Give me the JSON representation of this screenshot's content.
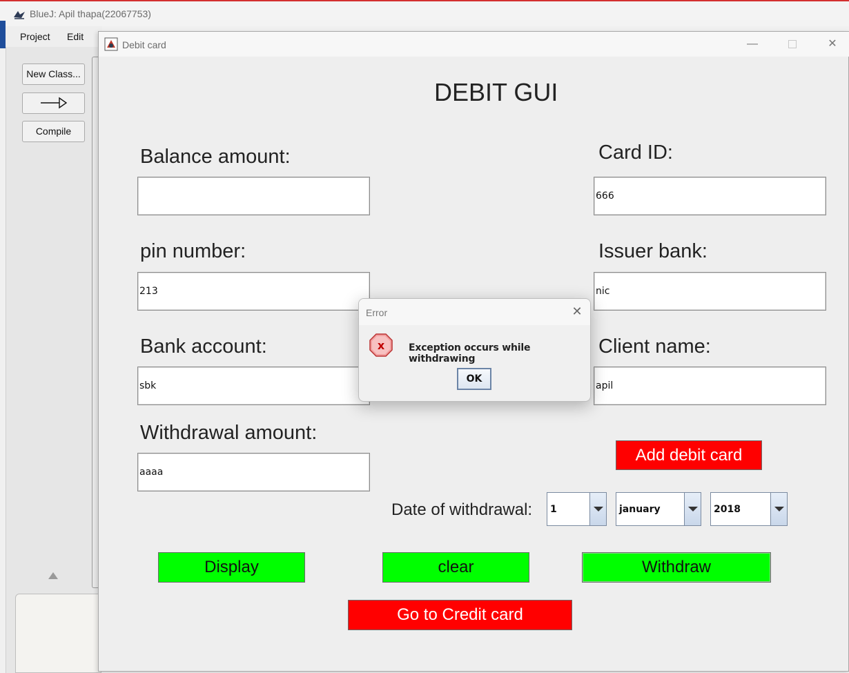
{
  "bluej": {
    "title": "BlueJ:  Apil thapa(22067753)",
    "menu": {
      "project": "Project",
      "edit": "Edit"
    },
    "buttons": {
      "new_class": "New Class...",
      "compile": "Compile"
    }
  },
  "debit_window": {
    "title": "Debit card",
    "heading": "DEBIT GUI",
    "fields": {
      "balance_amount": {
        "label": "Balance amount:",
        "value": ""
      },
      "card_id": {
        "label": "Card ID:",
        "value": "666"
      },
      "pin_number": {
        "label": "pin number:",
        "value": "213"
      },
      "issuer_bank": {
        "label": "Issuer bank:",
        "value": "nic"
      },
      "bank_account": {
        "label": "Bank account:",
        "value": "sbk"
      },
      "client_name": {
        "label": "Client name:",
        "value": "apil"
      },
      "withdrawal_amount": {
        "label": "Withdrawal amount:",
        "value": "aaaa"
      }
    },
    "date_of_withdrawal": {
      "label": "Date of withdrawal:",
      "day": "1",
      "month": "january",
      "year": "2018"
    },
    "buttons": {
      "add_debit_card": "Add debit card",
      "display": "Display",
      "clear": "clear",
      "withdraw": "Withdraw",
      "go_to_credit": "Go to Credit card"
    }
  },
  "error_dialog": {
    "title": "Error",
    "message": "Exception occurs while withdrawing",
    "ok": "OK",
    "icon": "error-x-icon"
  },
  "colors": {
    "green_button": "#00ff00",
    "red_button": "#ff0000"
  }
}
